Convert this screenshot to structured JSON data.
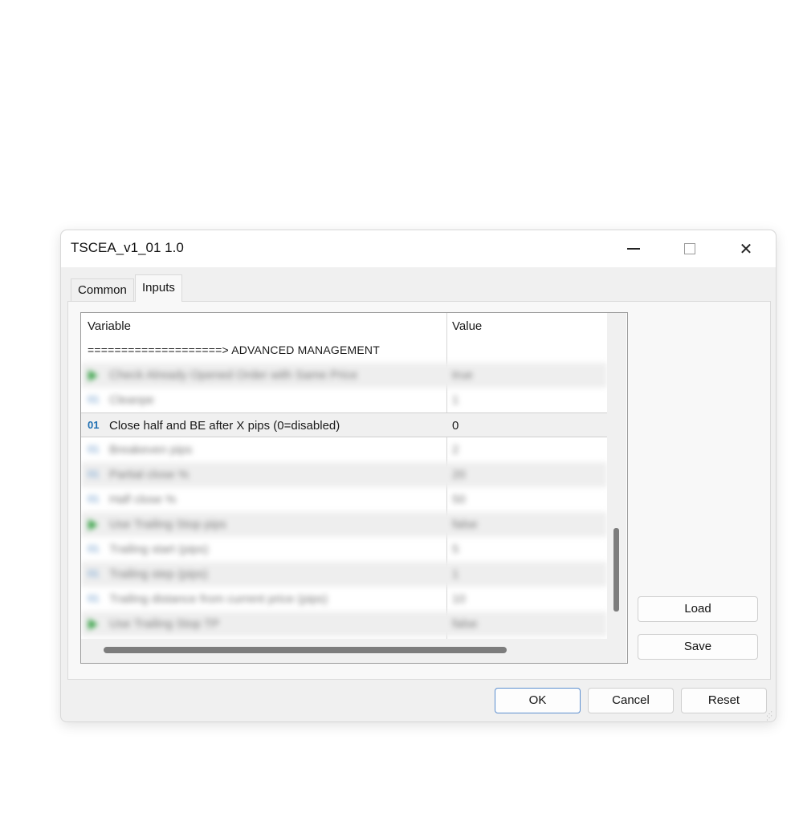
{
  "window": {
    "title": "TSCEA_v1_01 1.0",
    "controls": {
      "minimize_icon": "minimize-icon",
      "maximize_icon": "maximize-icon",
      "close_icon": "close-icon",
      "close_glyph": "✕"
    }
  },
  "tabs": [
    {
      "label": "Common",
      "active": false
    },
    {
      "label": "Inputs",
      "active": true
    }
  ],
  "grid": {
    "columns": {
      "variable": "Variable",
      "value": "Value"
    },
    "section_header": "====================> ADVANCED MANAGEMENT",
    "rows": [
      {
        "icon": "bool",
        "name": "Check Already Opened Order with Same Price",
        "value": "true",
        "blurred": true
      },
      {
        "icon": "int",
        "name": "Cleanpe",
        "value": "1",
        "blurred": true
      },
      {
        "icon": "int",
        "icon_text": "01",
        "name": "Close half and BE after X pips (0=disabled)",
        "value": "0",
        "blurred": false,
        "selected": true
      },
      {
        "icon": "int",
        "name": "Breakeven pips",
        "value": "2",
        "blurred": true
      },
      {
        "icon": "int",
        "name": "Partial close %",
        "value": "20",
        "blurred": true
      },
      {
        "icon": "int",
        "name": "Half close %",
        "value": "50",
        "blurred": true
      },
      {
        "icon": "bool",
        "name": "Use Trailing Stop pips",
        "value": "false",
        "blurred": true
      },
      {
        "icon": "int",
        "name": "Trailing start (pips)",
        "value": "5",
        "blurred": true
      },
      {
        "icon": "int",
        "name": "Trailing step (pips)",
        "value": "1",
        "blurred": true
      },
      {
        "icon": "int",
        "name": "Trailing distance from current price (pips)",
        "value": "10",
        "blurred": true
      },
      {
        "icon": "bool",
        "name": "Use Trailing Stop TP",
        "value": "false",
        "blurred": true
      }
    ]
  },
  "buttons": {
    "load": "Load",
    "save": "Save",
    "ok": "OK",
    "cancel": "Cancel",
    "reset": "Reset"
  },
  "colors": {
    "accent_border": "#5c8fd0",
    "bool_icon": "#2e9e3e",
    "int_icon": "#1f6fb2"
  }
}
